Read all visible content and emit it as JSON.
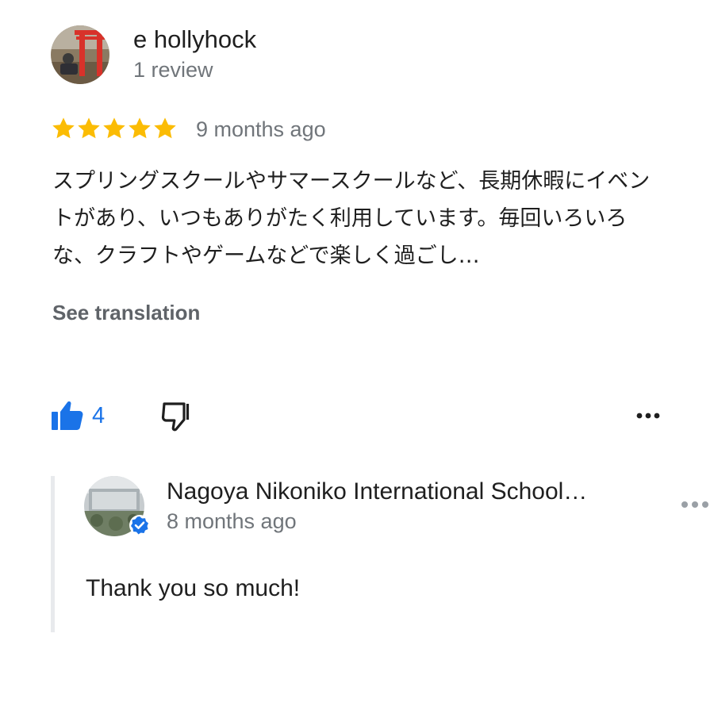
{
  "review": {
    "author": {
      "name": "e hollyhock",
      "meta": "1 review",
      "avatar_icon": "profile-photo-torii-gate"
    },
    "rating": 5,
    "rating_max": 5,
    "time_ago": "9 months ago",
    "text": "スプリングスクールやサマースクールなど、長期休暇にイベントがあり、いつもありがたく利用しています。毎回いろいろな、クラフトやゲームなどで楽しく過ごし…",
    "see_translation_label": "See translation",
    "actions": {
      "like_icon": "thumbs-up-filled-icon",
      "like_count": "4",
      "dislike_icon": "thumbs-down-outline-icon",
      "more_icon": "more-horizontal-icon"
    }
  },
  "owner_reply": {
    "name": "Nagoya Nikoniko International School…",
    "time_ago": "8 months ago",
    "text": "Thank you so much!",
    "verified_icon": "verified-check-icon",
    "more_icon": "more-horizontal-icon"
  },
  "colors": {
    "star": "#fbbc04",
    "accent_blue": "#1a73e8",
    "secondary_text": "#70757a",
    "primary_text": "#1f1f1f",
    "reply_bar": "#e8eaed"
  }
}
